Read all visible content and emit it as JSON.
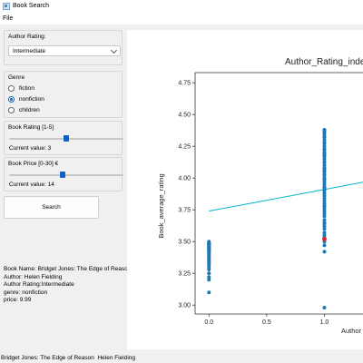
{
  "window": {
    "title": "Book Search"
  },
  "menu": {
    "file": "File"
  },
  "author_rating": {
    "label": "Author Rating:",
    "selected": "Intermediate"
  },
  "genre": {
    "label": "Genre",
    "options": [
      {
        "label": "fiction",
        "selected": false
      },
      {
        "label": "nonfiction",
        "selected": true
      },
      {
        "label": "children",
        "selected": false
      }
    ]
  },
  "book_rating": {
    "label": "Book Rating [1-5]",
    "min": 1,
    "max": 5,
    "value": 3,
    "current_text": "Current value: 3"
  },
  "book_price": {
    "label": "Book Price [0-30] €",
    "min": 0,
    "max": 30,
    "value": 14,
    "current_text": "Current value: 14"
  },
  "search_button": {
    "label": "Search"
  },
  "details": {
    "lines": [
      "Book Name: Bridget Jones: The Edge of Reason",
      "Author: Helen Fielding",
      "Author Rating:Intermediate",
      "genre: nonfiction",
      "price: 9.99"
    ]
  },
  "status": {
    "text": "Bridget Jones: The Edge of Reason  Helen Fielding"
  },
  "colors": {
    "points": "#1f77b4",
    "regression_line": "#17becf",
    "highlight": "#d62728",
    "accent": "#0a64c8"
  },
  "chart_data": {
    "type": "scatter",
    "title": "Author_Rating_inde",
    "xlabel": "Author",
    "ylabel": "Book_average_rating",
    "xlim": [
      -0.12,
      1.35
    ],
    "ylim": [
      2.93,
      4.83
    ],
    "x_ticks": [
      "0.0",
      "0.5",
      "1.0"
    ],
    "y_ticks": [
      "3.00",
      "3.25",
      "3.50",
      "3.75",
      "4.00",
      "4.25",
      "4.50",
      "4.75"
    ],
    "series": [
      {
        "x": [
          0,
          0,
          0,
          0,
          0,
          0,
          0,
          0,
          0,
          0,
          0,
          0,
          0,
          0,
          0,
          0,
          0,
          0,
          0,
          0,
          0,
          0,
          0,
          0,
          0,
          0,
          0,
          0,
          0,
          0,
          0,
          0,
          0,
          1,
          1,
          1,
          1,
          1,
          1,
          1,
          1,
          1,
          1,
          1,
          1,
          1,
          1,
          1,
          1,
          1,
          1,
          1,
          1,
          1,
          1,
          1,
          1,
          1,
          1,
          1,
          1,
          1,
          1,
          1,
          1,
          1,
          1,
          1,
          1,
          1,
          1,
          1,
          1,
          1,
          1,
          1,
          1,
          1,
          1,
          1,
          1,
          1,
          1,
          1,
          1,
          1,
          1,
          1,
          1,
          1
        ],
        "y": [
          3.1,
          3.2,
          3.22,
          3.25,
          3.28,
          3.3,
          3.32,
          3.33,
          3.34,
          3.35,
          3.36,
          3.37,
          3.38,
          3.39,
          3.4,
          3.41,
          3.42,
          3.42,
          3.43,
          3.43,
          3.44,
          3.44,
          3.45,
          3.45,
          3.46,
          3.46,
          3.47,
          3.47,
          3.48,
          3.48,
          3.49,
          3.49,
          3.5,
          2.98,
          3.42,
          3.47,
          3.5,
          3.53,
          3.55,
          3.57,
          3.6,
          3.62,
          3.65,
          3.67,
          3.7,
          3.72,
          3.74,
          3.76,
          3.78,
          3.8,
          3.82,
          3.84,
          3.86,
          3.88,
          3.9,
          3.92,
          3.93,
          3.95,
          3.97,
          3.99,
          4.0,
          4.02,
          4.03,
          4.05,
          4.07,
          4.08,
          4.1,
          4.12,
          4.13,
          4.15,
          4.17,
          4.18,
          4.2,
          4.22,
          4.23,
          4.25,
          4.27,
          4.28,
          4.3,
          4.32,
          4.33,
          4.35,
          4.36,
          4.37,
          4.38,
          3.64,
          3.78,
          3.91,
          4.06,
          4.19
        ]
      }
    ],
    "regression_line": {
      "x": [
        0,
        1.35
      ],
      "y": [
        3.74,
        3.97
      ]
    },
    "highlight_point": {
      "x": 1,
      "y": 3.52
    },
    "grid": false
  }
}
